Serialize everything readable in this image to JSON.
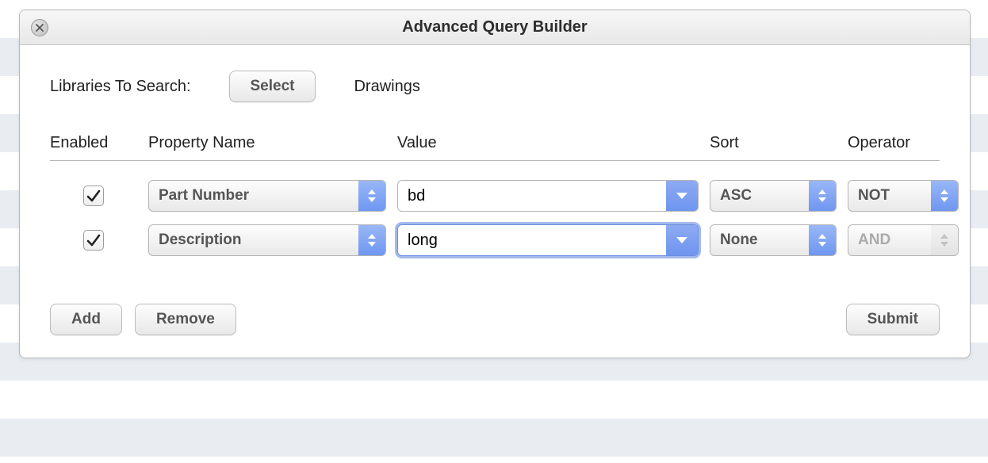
{
  "title": "Advanced Query Builder",
  "libraries": {
    "label": "Libraries To Search:",
    "select_button": "Select",
    "selected": "Drawings"
  },
  "headers": {
    "enabled": "Enabled",
    "property": "Property Name",
    "value": "Value",
    "sort": "Sort",
    "operator": "Operator"
  },
  "rows": [
    {
      "enabled": true,
      "property": "Part Number",
      "value": "bd",
      "sort": "ASC",
      "operator": "NOT",
      "operator_enabled": true,
      "focused": false
    },
    {
      "enabled": true,
      "property": "Description",
      "value": "long",
      "sort": "None",
      "operator": "AND",
      "operator_enabled": false,
      "focused": true
    }
  ],
  "buttons": {
    "add": "Add",
    "remove": "Remove",
    "submit": "Submit"
  }
}
